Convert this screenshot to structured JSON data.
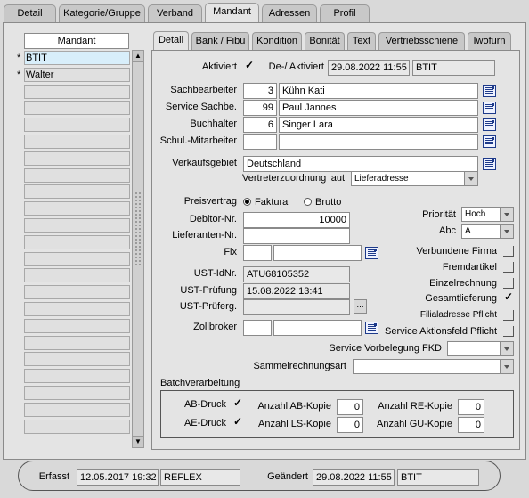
{
  "main_tabs": [
    "Detail",
    "Kategorie/Gruppe",
    "Verband",
    "Mandant",
    "Adressen",
    "Profil"
  ],
  "sub_tabs": [
    "Detail",
    "Bank / Fibu",
    "Kondition",
    "Bonität",
    "Text",
    "Vertriebsschiene",
    "Iwofurn"
  ],
  "mandant_list": {
    "header": "Mandant",
    "items": [
      {
        "marker": "*",
        "label": "BTIT"
      },
      {
        "marker": "*",
        "label": "Walter"
      }
    ]
  },
  "form": {
    "aktiviert_label": "Aktiviert",
    "aktiviert_check": "✓",
    "de_aktiviert_label": "De-/ Aktiviert",
    "de_aktiviert_date": "29.08.2022 11:55",
    "de_aktiviert_user": "BTIT",
    "sachbearbeiter_label": "Sachbearbeiter",
    "sachbearbeiter_nr": "3",
    "sachbearbeiter_name": "Kühn Kati",
    "service_label": "Service Sachbe.",
    "service_nr": "99",
    "service_name": "Paul Jannes",
    "buchhalter_label": "Buchhalter",
    "buchhalter_nr": "6",
    "buchhalter_name": "Singer Lara",
    "schul_label": "Schul.-Mitarbeiter",
    "verkaufsgebiet_label": "Verkaufsgebiet",
    "verkaufsgebiet_value": "Deutschland",
    "vertreter_label": "Vertreterzuordnung laut",
    "vertreter_value": "Lieferadresse",
    "preisvertrag_label": "Preisvertrag",
    "faktura_label": "Faktura",
    "brutto_label": "Brutto",
    "debitor_label": "Debitor-Nr.",
    "debitor_value": "10000",
    "lieferanten_label": "Lieferanten-Nr.",
    "fix_label": "Fix",
    "prioritaet_label": "Priorität",
    "prioritaet_value": "Hoch",
    "abc_label": "Abc",
    "abc_value": "A",
    "ust_idnr_label": "UST-IdNr.",
    "ust_idnr_value": "ATU68105352",
    "ust_pruefung_label": "UST-Prüfung",
    "ust_pruefung_value": "15.08.2022 13:41",
    "ust_pruefg_label": "UST-Prüferg.",
    "ellipsis": "...",
    "zollbroker_label": "Zollbroker",
    "verbundene_label": "Verbundene Firma",
    "fremdartikel_label": "Fremdartikel",
    "einzelrechnung_label": "Einzelrechnung",
    "gesamtlieferung_label": "Gesamtlieferung",
    "gesamtlieferung_check": "✓",
    "filialadresse_label": "Filialadresse Pflicht",
    "service_aktionsfeld_label": "Service Aktionsfeld Pflicht",
    "service_vorbelegung_label": "Service Vorbelegung FKD",
    "sammelrechnung_label": "Sammelrechnungsart"
  },
  "batch": {
    "title": "Batchverarbeitung",
    "ab_druck_label": "AB-Druck",
    "ab_druck_check": "✓",
    "ae_druck_label": "AE-Druck",
    "ae_druck_check": "✓",
    "ab_kopie_label": "Anzahl AB-Kopie",
    "ab_kopie_value": "0",
    "ls_kopie_label": "Anzahl LS-Kopie",
    "ls_kopie_value": "0",
    "re_kopie_label": "Anzahl RE-Kopie",
    "re_kopie_value": "0",
    "gu_kopie_label": "Anzahl GU-Kopie",
    "gu_kopie_value": "0"
  },
  "footer": {
    "erfasst_label": "Erfasst",
    "erfasst_date": "12.05.2017 19:32",
    "erfasst_user": "REFLEX",
    "geaendert_label": "Geändert",
    "geaendert_date": "29.08.2022 11:55",
    "geaendert_user": "BTIT"
  }
}
